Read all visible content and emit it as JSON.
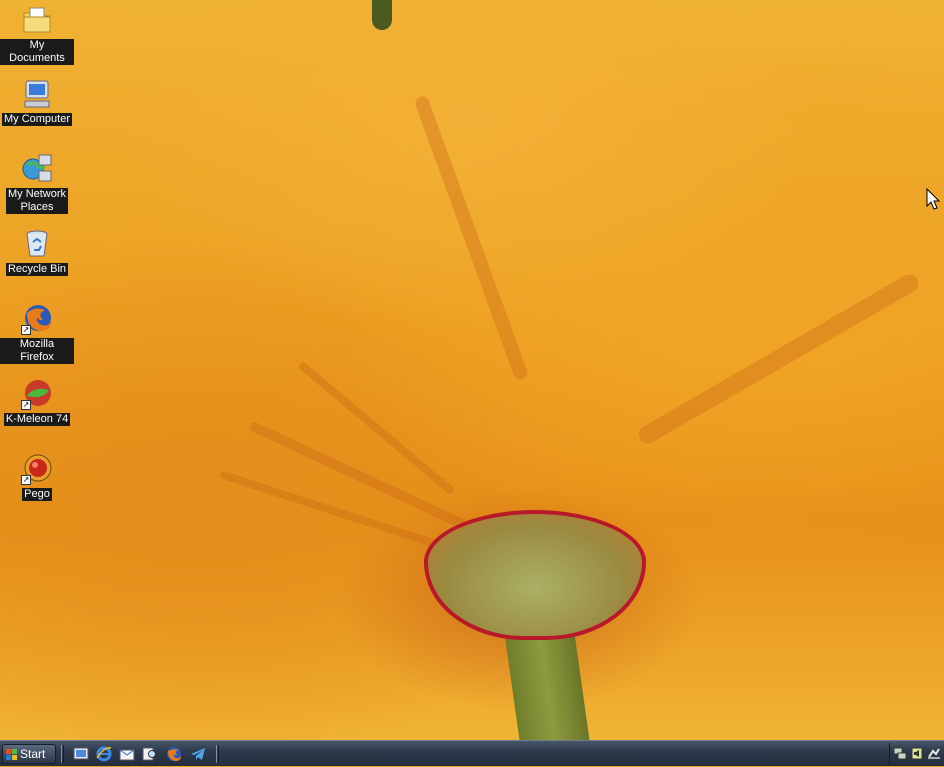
{
  "desktop": {
    "icons": [
      {
        "label": "My Documents",
        "icon": "folder-documents-icon"
      },
      {
        "label": "My Computer",
        "icon": "computer-icon"
      },
      {
        "label": "My Network\nPlaces",
        "icon": "network-places-icon"
      },
      {
        "label": "Recycle Bin",
        "icon": "recycle-bin-icon"
      },
      {
        "label": "Mozilla Firefox",
        "icon": "firefox-icon"
      },
      {
        "label": "K-Meleon 74",
        "icon": "kmeleon-icon"
      },
      {
        "label": "Pego",
        "icon": "pego-icon"
      }
    ]
  },
  "taskbar": {
    "start_label": "Start",
    "quick_launch": [
      "show-desktop-icon",
      "internet-explorer-icon",
      "outlook-express-icon",
      "search-icon",
      "firefox-icon",
      "telegram-icon"
    ],
    "tray": [
      "network-icon",
      "volume-icon",
      "safely-remove-icon"
    ]
  },
  "colors": {
    "label_bg": "#1a1a1a",
    "taskbar": "#2e3a4c"
  }
}
